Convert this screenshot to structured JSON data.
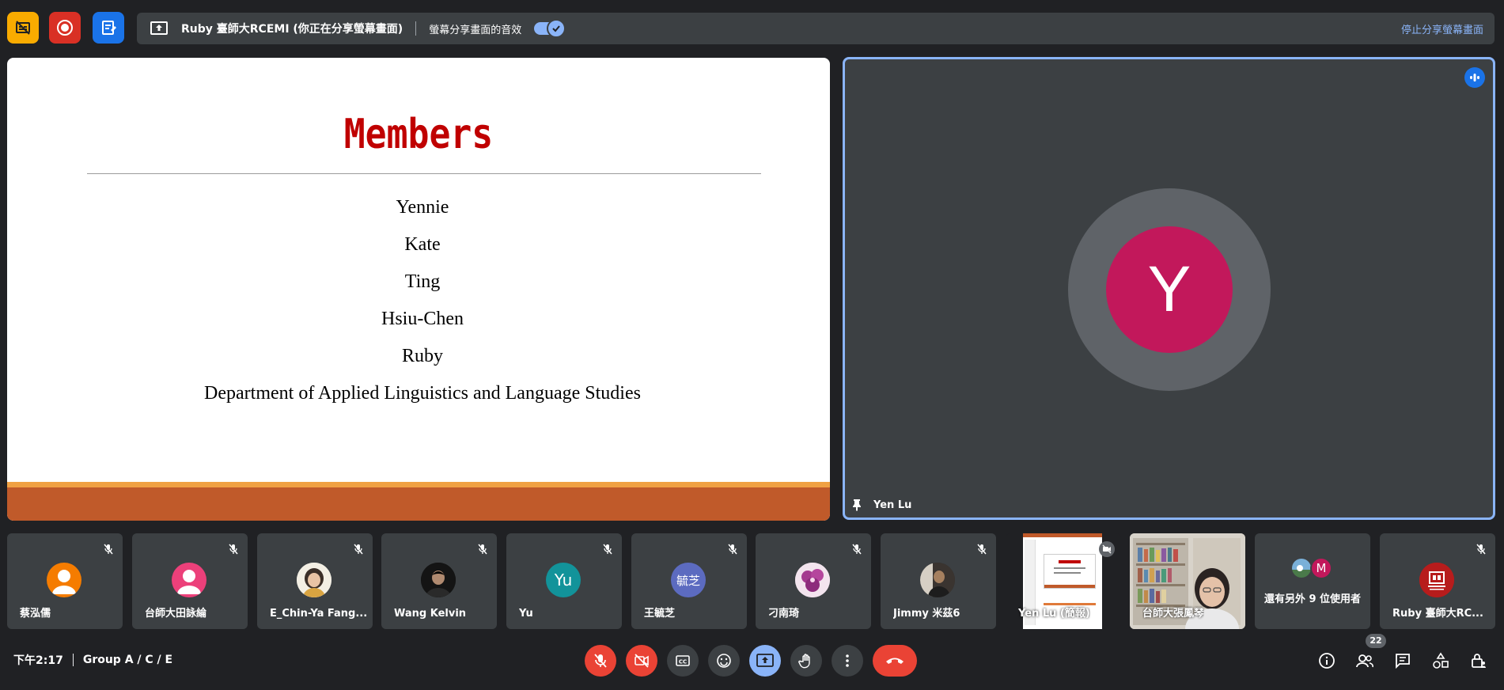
{
  "top_bar": {
    "share_banner": {
      "title": "Ruby 臺師大RCEMI (你正在分享螢幕畫面)",
      "audio_label": "螢幕分享畫面的音效",
      "stop_label": "停止分享螢幕畫面"
    }
  },
  "slide": {
    "title": "Members",
    "names": [
      "Yennie",
      "Kate",
      "Ting",
      "Hsiu-Chen",
      "Ruby",
      "Department of Applied Linguistics and Language Studies"
    ],
    "title_color": "#c00000",
    "bar_color": "#c05a2a"
  },
  "featured": {
    "initial": "Y",
    "name": "Yen Lu",
    "avatar_color": "#c2185b"
  },
  "participants": [
    {
      "name": "蔡泓儒",
      "avatar": "person",
      "color": "#f57c00"
    },
    {
      "name": "台師大田詠綸",
      "avatar": "person",
      "color": "#ec407a"
    },
    {
      "name": "E_Chin-Ya Fang...",
      "avatar": "photo"
    },
    {
      "name": "Wang Kelvin",
      "avatar": "photo"
    },
    {
      "name": "Yu",
      "avatar": "initial",
      "initial": "Yu",
      "color": "#12939a"
    },
    {
      "name": "王毓芝",
      "avatar": "initial",
      "initial": "毓芝",
      "color": "#5c6bc0"
    },
    {
      "name": "刁南琦",
      "avatar": "photo"
    },
    {
      "name": "Jimmy 米茲6",
      "avatar": "photo"
    },
    {
      "name": "Yen Lu (簡報)",
      "avatar": "screen"
    },
    {
      "name": "台師大張鳳琴",
      "avatar": "video"
    },
    {
      "name": "還有另外 9 位使用者",
      "avatar": "group",
      "initial": "M",
      "color": "#c2185b"
    },
    {
      "name": "Ruby 臺師大RC...",
      "avatar": "logo",
      "color": "#b71c1c"
    }
  ],
  "bottom_bar": {
    "time": "下午2:17",
    "meeting_name": "Group A / C / E",
    "people_count": "22"
  },
  "colors": {
    "background": "#202124",
    "tile": "#3c4043",
    "accent": "#8ab4f8",
    "danger": "#ea4335"
  }
}
